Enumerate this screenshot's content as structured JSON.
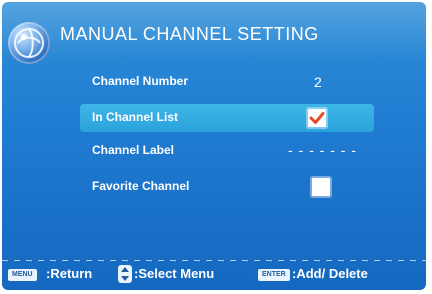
{
  "menu": {
    "title": "MANUAL CHANNEL SETTING",
    "items": [
      {
        "label": "Channel Number",
        "value": "2"
      },
      {
        "label": "In Channel List",
        "checked": true
      },
      {
        "label": "Channel Label",
        "value": "- - - - - - -"
      },
      {
        "label": "Favorite Channel",
        "checked": false
      }
    ]
  },
  "footer": {
    "menu_key": "MENU",
    "return_label": ":Return",
    "select_label": ":Select Menu",
    "enter_key": "ENTER",
    "add_delete_label": ":Add/ Delete"
  },
  "colors": {
    "background": "#1f7bd1",
    "highlight": "#3fb6e8",
    "checkmark": "#e64a2e"
  },
  "icons": [
    "globe-logo-icon",
    "checkmark-icon",
    "up-down-arrows-icon"
  ]
}
